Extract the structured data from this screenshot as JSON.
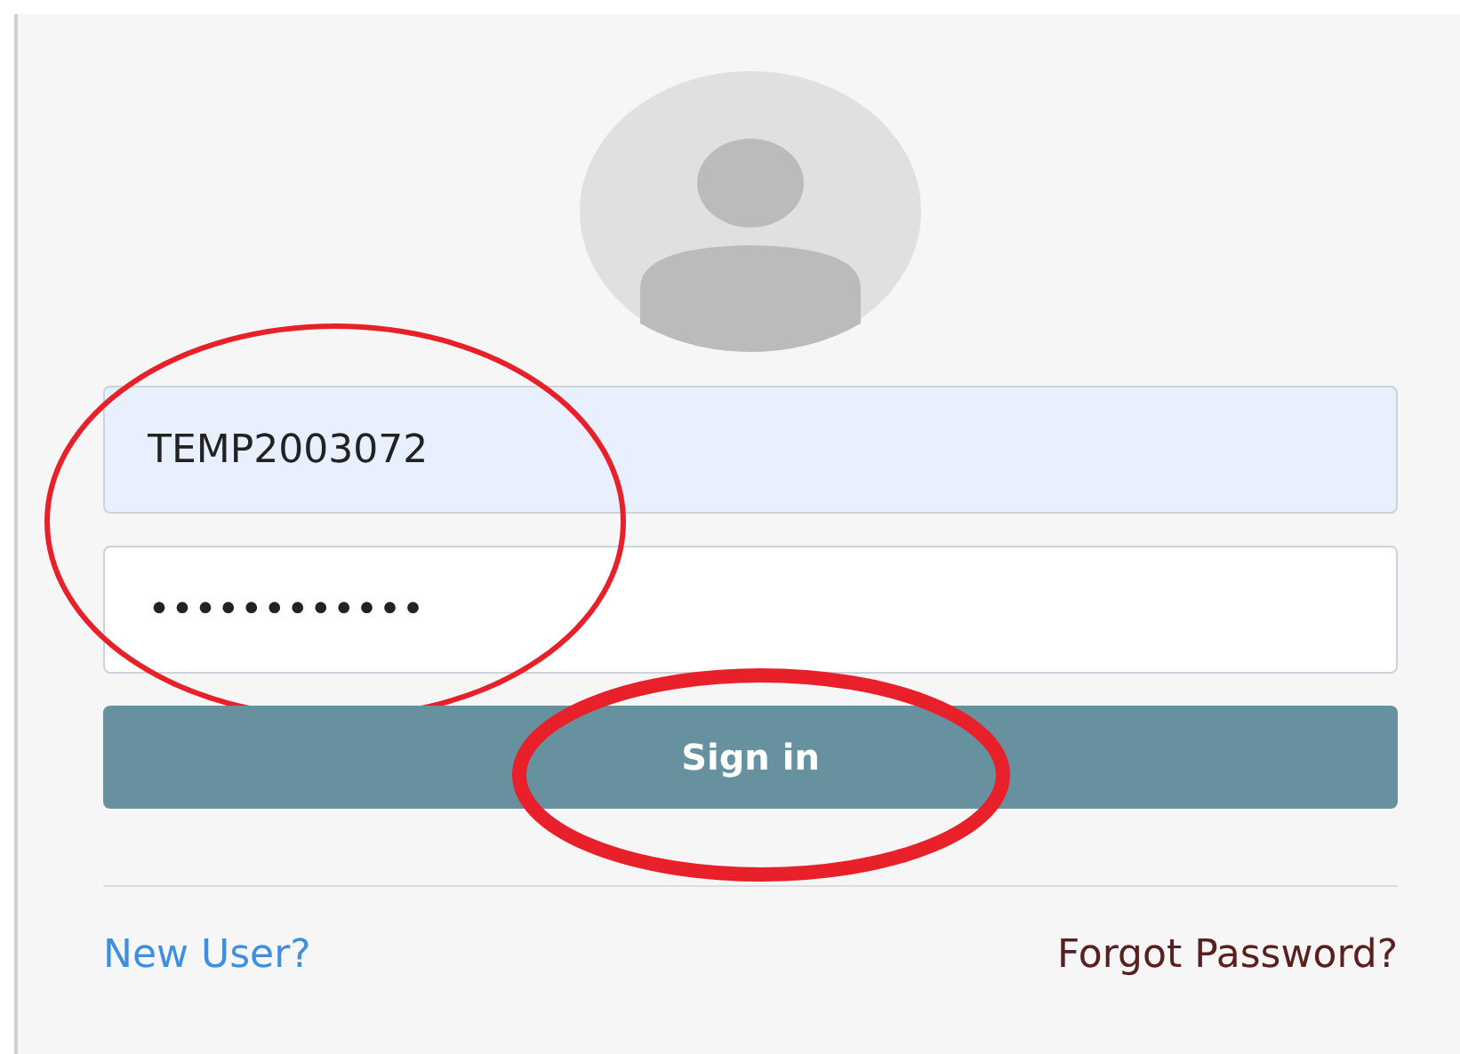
{
  "credentials": {
    "circled": true,
    "username": {
      "value": "TEMP2003072",
      "autofilled": true
    },
    "password": {
      "value": "••••••••••••",
      "autofilled": false
    }
  },
  "sign_in": {
    "label": "Sign in",
    "circled": true
  },
  "links": [
    {
      "kind": "new_user",
      "label": "New User?"
    },
    {
      "kind": "forgot",
      "label": "Forgot Password?"
    }
  ]
}
